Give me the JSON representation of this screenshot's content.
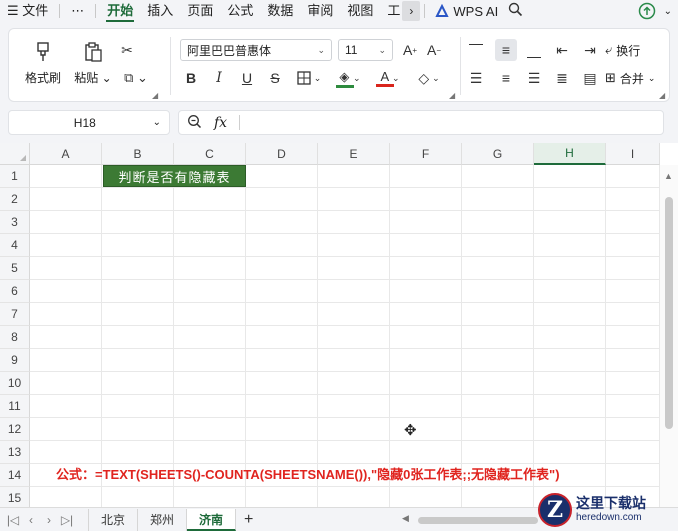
{
  "menubar": {
    "items": [
      "☰ 文件",
      "⋯",
      "开始",
      "插入",
      "页面",
      "公式",
      "数据",
      "审阅",
      "视图",
      "工"
    ],
    "active_index": 2,
    "more_arrow": "›",
    "wps_ai": "WPS AI"
  },
  "ribbon": {
    "format_painter": "格式刷",
    "paste": "粘贴",
    "font_name": "阿里巴巴普惠体",
    "font_size": "11",
    "bold": "B",
    "italic": "I",
    "underline": "U",
    "strike": "S",
    "wrap_text": "换行",
    "merge": "合并",
    "font_color_accent": "#2e8b3e",
    "font_color_red": "#d9251c"
  },
  "formula_bar": {
    "name_box": "H18",
    "fx": "fx",
    "content": ""
  },
  "grid": {
    "columns": [
      "A",
      "B",
      "C",
      "D",
      "E",
      "F",
      "G",
      "H",
      "I"
    ],
    "selected_column": "H",
    "rows": [
      "1",
      "2",
      "3",
      "4",
      "5",
      "6",
      "7",
      "8",
      "9",
      "10",
      "11",
      "12",
      "13",
      "14",
      "15"
    ],
    "b1_text": "判断是否有隐藏表",
    "b1_fill": "#3c7a34",
    "formula_note": "公式：=TEXT(SHEETS()-COUNTA(SHEETSNAME()),\"隐藏0张工作表;;无隐藏工作表\")"
  },
  "sheet_tabs": {
    "tabs": [
      "北京",
      "郑州",
      "济南"
    ],
    "active_index": 2,
    "add": "+"
  },
  "watermark": {
    "logo_letter": "Z",
    "title": "这里下载站",
    "subtitle": "heredown.com"
  }
}
